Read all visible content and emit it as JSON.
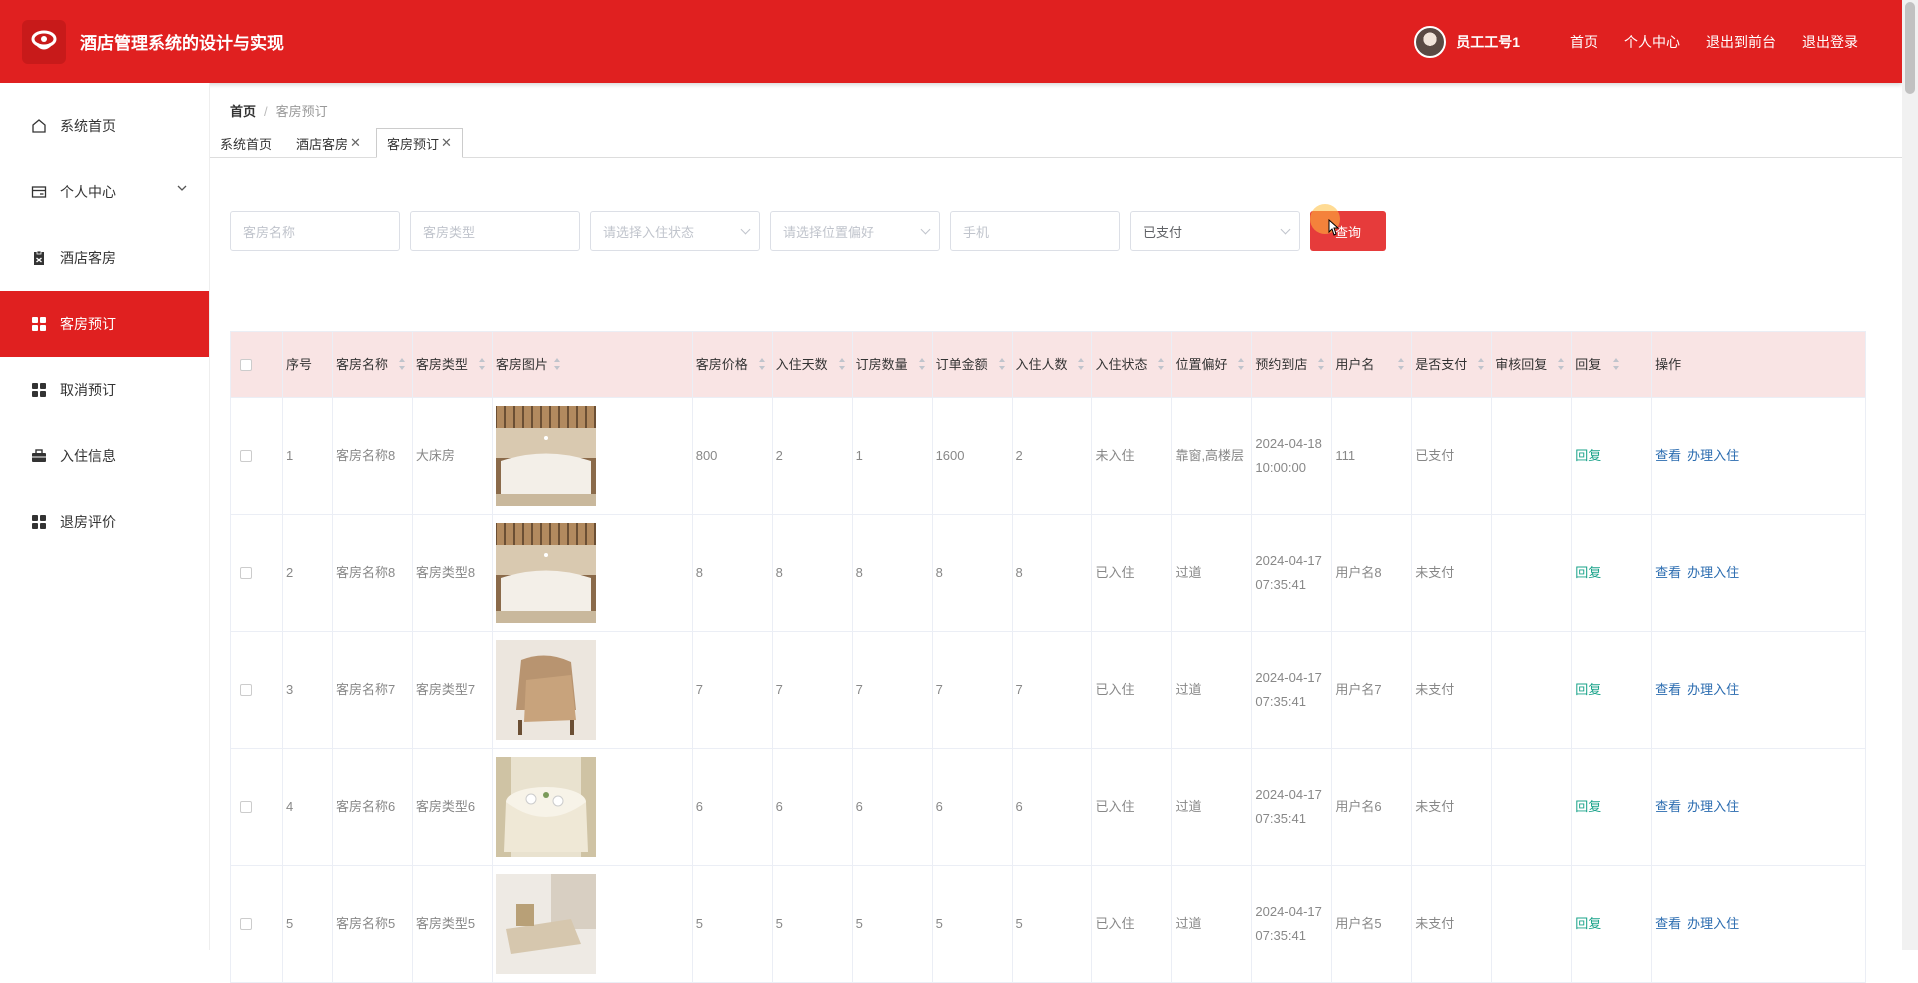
{
  "header": {
    "title": "酒店管理系统的设计与实现",
    "user": "员工工号1",
    "links": [
      "首页",
      "个人中心",
      "退出到前台",
      "退出登录"
    ]
  },
  "sidebar": {
    "items": [
      {
        "label": "系统首页",
        "icon": "home-icon"
      },
      {
        "label": "个人中心",
        "icon": "card-icon"
      },
      {
        "label": "酒店客房",
        "icon": "clipboard-icon"
      },
      {
        "label": "客房预订",
        "icon": "grid-icon"
      },
      {
        "label": "取消预订",
        "icon": "grid-icon"
      },
      {
        "label": "入住信息",
        "icon": "briefcase-icon"
      },
      {
        "label": "退房评价",
        "icon": "grid-icon"
      }
    ],
    "active_index": 3
  },
  "breadcrumb": {
    "home": "首页",
    "current": "客房预订"
  },
  "tabs": [
    {
      "label": "系统首页",
      "closable": false
    },
    {
      "label": "酒店客房",
      "closable": true
    },
    {
      "label": "客房预订",
      "closable": true
    }
  ],
  "search": {
    "room_name_placeholder": "客房名称",
    "room_type_placeholder": "客房类型",
    "checkin_status_placeholder": "请选择入住状态",
    "position_pref_placeholder": "请选择位置偏好",
    "phone_placeholder": "手机",
    "paid_value": "已支付",
    "query_label": "查询"
  },
  "table": {
    "headers": [
      "序号",
      "客房名称",
      "客房类型",
      "客房图片",
      "客房价格",
      "入住天数",
      "订房数量",
      "订单金额",
      "入住人数",
      "入住状态",
      "位置偏好",
      "预约到店",
      "用户名",
      "是否支付",
      "审核回复",
      "回复",
      "操作"
    ],
    "reply_label": "回复",
    "view_label": "查看",
    "checkin_label": "办理入住",
    "rows": [
      {
        "no": "1",
        "name": "客房名称8",
        "type": "大床房",
        "price": "800",
        "days": "2",
        "count": "1",
        "amount": "1600",
        "people": "2",
        "status": "未入住",
        "pref": "靠窗,高楼层",
        "date": "2024-04-18",
        "time": "10:00:00",
        "user": "111",
        "paid": "已支付",
        "img": "lobby"
      },
      {
        "no": "2",
        "name": "客房名称8",
        "type": "客房类型8",
        "price": "8",
        "days": "8",
        "count": "8",
        "amount": "8",
        "people": "8",
        "status": "已入住",
        "pref": "过道",
        "date": "2024-04-17",
        "time": "07:35:41",
        "user": "用户名8",
        "paid": "未支付",
        "img": "lobby"
      },
      {
        "no": "3",
        "name": "客房名称7",
        "type": "客房类型7",
        "price": "7",
        "days": "7",
        "count": "7",
        "amount": "7",
        "people": "7",
        "status": "已入住",
        "pref": "过道",
        "date": "2024-04-17",
        "time": "07:35:41",
        "user": "用户名7",
        "paid": "未支付",
        "img": "chair"
      },
      {
        "no": "4",
        "name": "客房名称6",
        "type": "客房类型6",
        "price": "6",
        "days": "6",
        "count": "6",
        "amount": "6",
        "people": "6",
        "status": "已入住",
        "pref": "过道",
        "date": "2024-04-17",
        "time": "07:35:41",
        "user": "用户名6",
        "paid": "未支付",
        "img": "table"
      },
      {
        "no": "5",
        "name": "客房名称5",
        "type": "客房类型5",
        "price": "5",
        "days": "5",
        "count": "5",
        "amount": "5",
        "people": "5",
        "status": "已入住",
        "pref": "过道",
        "date": "2024-04-17",
        "time": "07:35:41",
        "user": "用户名5",
        "paid": "未支付",
        "img": "sofa"
      }
    ]
  },
  "colors": {
    "brand": "#e02020",
    "header_row": "#f9e4e4",
    "reply": "#1aa38a",
    "link": "#2b6cb0"
  }
}
